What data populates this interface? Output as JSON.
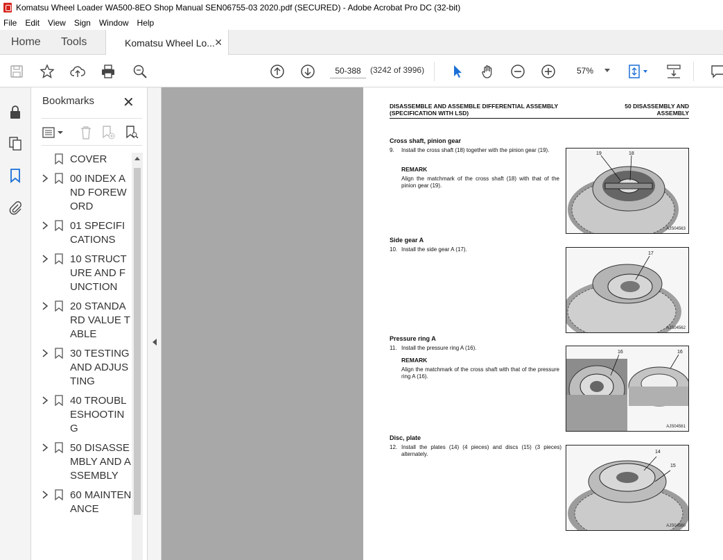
{
  "window": {
    "title": "Komatsu Wheel Loader WA500-8EO Shop Manual SEN06755-03 2020.pdf (SECURED) - Adobe Acrobat Pro DC (32-bit)"
  },
  "menu": [
    "File",
    "Edit",
    "View",
    "Sign",
    "Window",
    "Help"
  ],
  "tabs": {
    "home": "Home",
    "tools": "Tools",
    "doc": "Komatsu Wheel Lo...",
    "doc_close": "✕"
  },
  "toolbar": {
    "page_value": "50-388",
    "page_count": "(3242 of 3996)",
    "zoom": "57%"
  },
  "bookmarks": {
    "title": "Bookmarks",
    "close": "✕",
    "items": [
      {
        "label": "COVER",
        "expandable": false
      },
      {
        "label": "00 INDEX AND FOREWORD",
        "expandable": true
      },
      {
        "label": "01 SPECIFICATIONS",
        "expandable": true
      },
      {
        "label": "10 STRUCTURE AND FUNCTION",
        "expandable": true
      },
      {
        "label": "20 STANDARD VALUE TABLE",
        "expandable": true
      },
      {
        "label": "30 TESTING AND ADJUSTING",
        "expandable": true
      },
      {
        "label": "40 TROUBLESHOOTING",
        "expandable": true
      },
      {
        "label": "50 DISASSEMBLY AND ASSEMBLY",
        "expandable": true
      },
      {
        "label": "60 MAINTENANCE",
        "expandable": true
      }
    ]
  },
  "document": {
    "header_left": "DISASSEMBLE AND ASSEMBLE DIFFERENTIAL ASSEMBLY (SPECIFICATION WITH LSD)",
    "header_right": "50 DISASSEMBLY AND ASSEMBLY",
    "sections": [
      {
        "title": "Cross shaft, pinion gear",
        "step_num": "9.",
        "step_text": "Install the cross shaft (18) together with the pinion gear (19).",
        "remark_label": "REMARK",
        "remark_text": "Align the matchmark of the cross shaft (18) with that of the pinion gear (19).",
        "fig_code": "AJS04563",
        "callouts": [
          "19",
          "18"
        ]
      },
      {
        "title": "Side gear A",
        "step_num": "10.",
        "step_text": "Install the side gear A (17).",
        "fig_code": "AJS04562",
        "callouts": [
          "17"
        ]
      },
      {
        "title": "Pressure ring A",
        "step_num": "11.",
        "step_text": "Install the pressure ring A (16).",
        "remark_label": "REMARK",
        "remark_text": "Align the matchmark of the cross shaft with that of the pressure ring A (16).",
        "fig_code": "AJS04561",
        "callouts": [
          "16",
          "16"
        ]
      },
      {
        "title": "Disc, plate",
        "step_num": "12.",
        "step_text": "Install the plates (14) (4 pieces) and discs (15) (3 pieces) alternately.",
        "fig_code": "AJS04560",
        "callouts": [
          "14",
          "15"
        ]
      }
    ]
  }
}
